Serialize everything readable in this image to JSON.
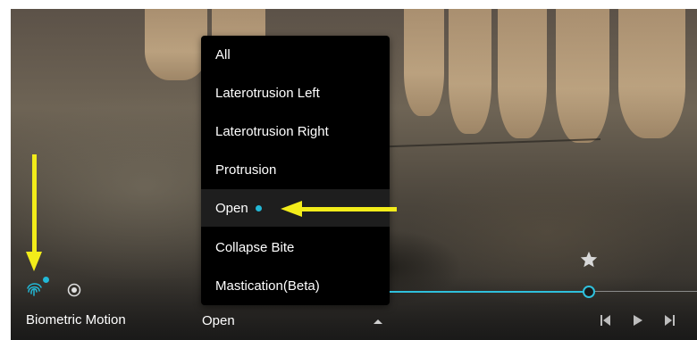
{
  "header_partial_text": "",
  "dropdown": {
    "items": [
      {
        "label": "All",
        "selected": false
      },
      {
        "label": "Laterotrusion Left",
        "selected": false
      },
      {
        "label": "Laterotrusion Right",
        "selected": false
      },
      {
        "label": "Protrusion",
        "selected": false
      },
      {
        "label": "Open",
        "selected": true
      },
      {
        "label": "Collapse Bite",
        "selected": false
      },
      {
        "label": "Mastication(Beta)",
        "selected": false
      }
    ]
  },
  "bottom_bar": {
    "mode_label": "Biometric Motion",
    "selected_motion": "Open"
  },
  "colors": {
    "accent": "#22b8d6",
    "annotation_arrow": "#f2ec1a",
    "menu_bg": "#000000"
  },
  "icons": [
    "fingerprint-icon",
    "record-icon",
    "star-icon",
    "caret-up-icon",
    "skip-back-icon",
    "play-icon",
    "skip-forward-icon"
  ]
}
